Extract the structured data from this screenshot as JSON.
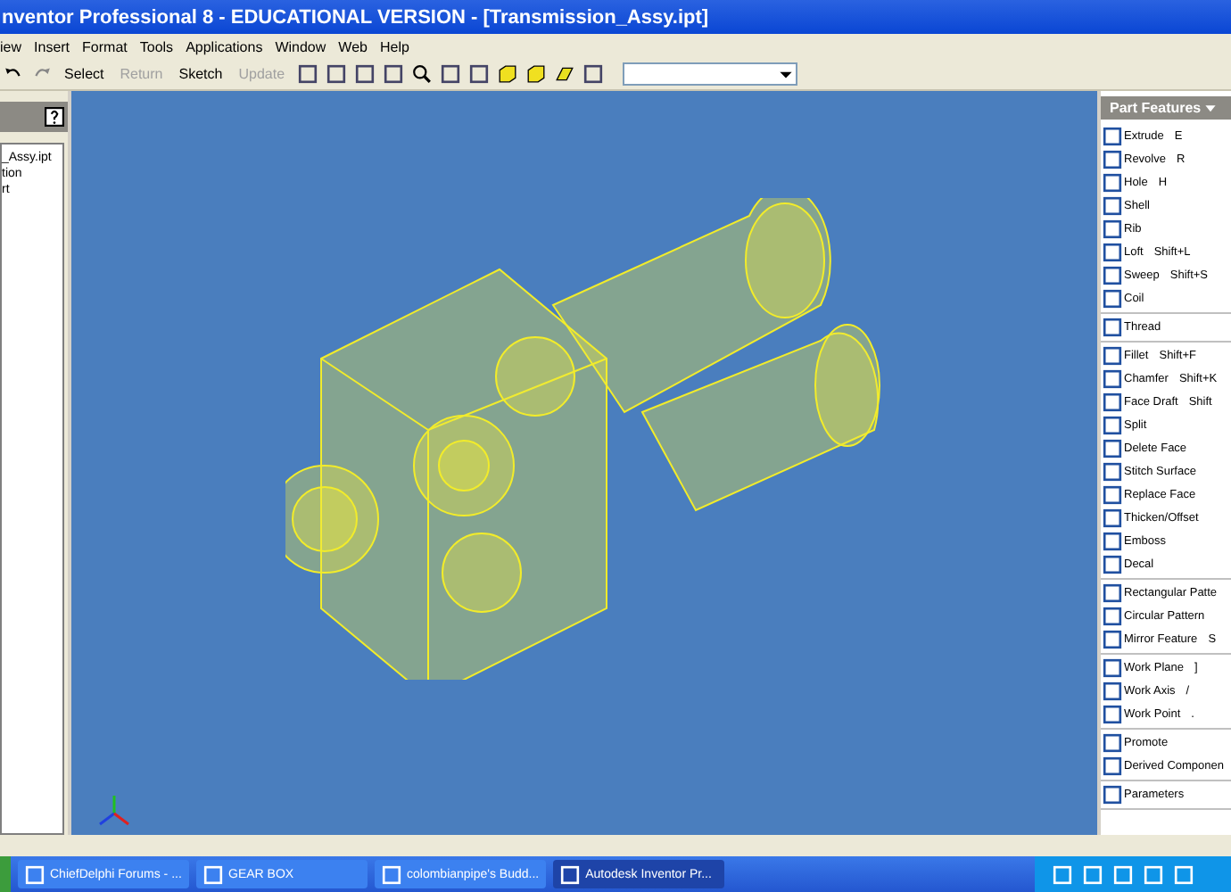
{
  "window": {
    "title": "nventor Professional 8  - EDUCATIONAL VERSION - [Transmission_Assy.ipt]"
  },
  "menu": [
    "iew",
    "Insert",
    "Format",
    "Tools",
    "Applications",
    "Window",
    "Web",
    "Help"
  ],
  "toolbar": [
    {
      "kind": "undo"
    },
    {
      "kind": "redo"
    },
    {
      "kind": "text",
      "label": "Select",
      "disabled": false
    },
    {
      "kind": "text",
      "label": "Return",
      "disabled": true
    },
    {
      "kind": "text",
      "label": "Sketch",
      "disabled": false
    },
    {
      "kind": "text",
      "label": "Update",
      "disabled": true
    },
    {
      "kind": "tool"
    },
    {
      "kind": "tool"
    },
    {
      "kind": "tool"
    },
    {
      "kind": "tool"
    },
    {
      "kind": "zoom"
    },
    {
      "kind": "tool"
    },
    {
      "kind": "tool"
    },
    {
      "kind": "cube"
    },
    {
      "kind": "cube"
    },
    {
      "kind": "plane"
    },
    {
      "kind": "tool"
    },
    {
      "kind": "combo"
    }
  ],
  "browser": {
    "items": [
      "_Assy.ipt",
      "tion",
      "rt"
    ]
  },
  "panel": {
    "title": "Part Features",
    "groups": [
      [
        {
          "label": "Extrude",
          "shortcut": "E"
        },
        {
          "label": "Revolve",
          "shortcut": "R"
        },
        {
          "label": "Hole",
          "shortcut": "H"
        },
        {
          "label": "Shell"
        },
        {
          "label": "Rib"
        },
        {
          "label": "Loft",
          "shortcut": "Shift+L"
        },
        {
          "label": "Sweep",
          "shortcut": "Shift+S"
        },
        {
          "label": "Coil"
        }
      ],
      [
        {
          "label": "Thread"
        }
      ],
      [
        {
          "label": "Fillet",
          "shortcut": "Shift+F"
        },
        {
          "label": "Chamfer",
          "shortcut": "Shift+K"
        },
        {
          "label": "Face Draft",
          "shortcut": "Shift"
        },
        {
          "label": "Split"
        },
        {
          "label": "Delete Face"
        },
        {
          "label": "Stitch Surface"
        },
        {
          "label": "Replace Face"
        },
        {
          "label": "Thicken/Offset"
        },
        {
          "label": "Emboss"
        },
        {
          "label": "Decal"
        }
      ],
      [
        {
          "label": "Rectangular Patte"
        },
        {
          "label": "Circular Pattern"
        },
        {
          "label": "Mirror Feature",
          "shortcut": "S"
        }
      ],
      [
        {
          "label": "Work Plane",
          "shortcut": "]"
        },
        {
          "label": "Work Axis",
          "shortcut": "/"
        },
        {
          "label": "Work Point",
          "shortcut": "."
        }
      ],
      [
        {
          "label": "Promote"
        },
        {
          "label": "Derived Componen"
        }
      ],
      [
        {
          "label": "Parameters"
        }
      ]
    ]
  },
  "taskbar": [
    {
      "label": "ChiefDelphi Forums - ...",
      "selected": false
    },
    {
      "label": "GEAR BOX",
      "selected": false
    },
    {
      "label": "colombianpipe's Budd...",
      "selected": false
    },
    {
      "label": "Autodesk Inventor Pr...",
      "selected": true
    }
  ]
}
